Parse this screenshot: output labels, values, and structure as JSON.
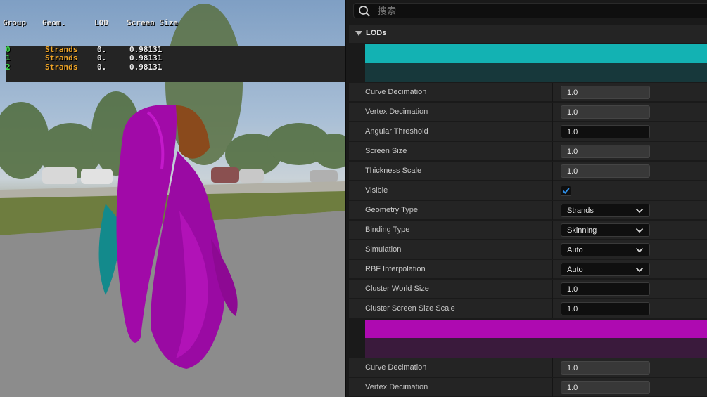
{
  "viewport": {
    "stats": {
      "headers": [
        "Group",
        "Geom.",
        "LOD",
        "Screen Size"
      ],
      "rows": [
        {
          "group": "0",
          "geom": "Strands",
          "lod": "0.",
          "size": "0.98131"
        },
        {
          "group": "1",
          "geom": "Strands",
          "lod": "0.",
          "size": "0.98131"
        },
        {
          "group": "2",
          "geom": "Strands",
          "lod": "0.",
          "size": "0.98131"
        }
      ]
    }
  },
  "details": {
    "search_placeholder": "搜索",
    "section_title": "LODs",
    "group0": {
      "color": "#13b2b3",
      "dark_color": "#17383b",
      "props": [
        {
          "label": "Curve Decimation",
          "value": "1.0"
        },
        {
          "label": "Vertex Decimation",
          "value": "1.0"
        },
        {
          "label": "Angular Threshold",
          "value": "1.0"
        },
        {
          "label": "Screen Size",
          "value": "1.0"
        },
        {
          "label": "Thickness Scale",
          "value": "1.0"
        },
        {
          "label": "Visible",
          "checked": true
        },
        {
          "label": "Geometry Type",
          "value": "Strands"
        },
        {
          "label": "Binding Type",
          "value": "Skinning"
        },
        {
          "label": "Simulation",
          "value": "Auto"
        },
        {
          "label": "RBF Interpolation",
          "value": "Auto"
        },
        {
          "label": "Cluster World Size",
          "value": "1.0"
        },
        {
          "label": "Cluster Screen Size Scale",
          "value": "1.0"
        }
      ]
    },
    "group1": {
      "color": "#ae0ab1",
      "dark_color": "#3a1a3c",
      "props": [
        {
          "label": "Curve Decimation",
          "value": "1.0"
        },
        {
          "label": "Vertex Decimation",
          "value": "1.0"
        }
      ]
    }
  },
  "icons": {
    "search": "search-icon",
    "collapse": "triangle-down-icon",
    "dropdown": "chevron-down-icon",
    "check": "checkmark-icon"
  },
  "colors": {
    "accent_check": "#2f8fe8",
    "hair_purple": "#a10aa8",
    "hair_teal": "#138a8c",
    "hair_brown": "#8a4a1c"
  }
}
